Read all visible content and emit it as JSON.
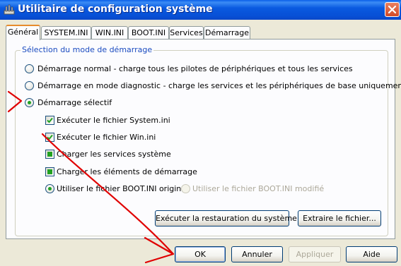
{
  "window": {
    "title": "Utilitaire de configuration système",
    "title_icon": "msconfig-icon",
    "close_icon": "close-icon"
  },
  "tabs": [
    {
      "label": "Général",
      "active": true
    },
    {
      "label": "SYSTEM.INI",
      "active": false
    },
    {
      "label": "WIN.INI",
      "active": false
    },
    {
      "label": "BOOT.INI",
      "active": false
    },
    {
      "label": "Services",
      "active": false
    },
    {
      "label": "Démarrage",
      "active": false
    }
  ],
  "startup_group": {
    "legend": "Sélection du mode de démarrage",
    "radio_normal": "Démarrage normal - charge tous les pilotes de périphériques et tous les services",
    "radio_diagnostic": "Démarrage en mode diagnostic - charge les services et les périphériques de base uniquement",
    "radio_selective": "Démarrage sélectif",
    "selected_mode": "selective",
    "chk_system_ini": "Exécuter le fichier System.ini",
    "chk_win_ini": "Exécuter le fichier Win.ini",
    "chk_services": "Charger les services système",
    "chk_startup": "Charger les éléments de démarrage",
    "radio_boot_original": "Utiliser le fichier BOOT.INI original",
    "radio_boot_modified": "Utiliser le fichier BOOT.INI modifié",
    "btn_restore": "Exécuter la restauration du système",
    "btn_extract": "Extraire le fichier..."
  },
  "buttons": {
    "ok": "OK",
    "cancel": "Annuler",
    "apply": "Appliquer",
    "help": "Aide"
  },
  "annotation": {
    "arrow_color": "#e00000"
  }
}
